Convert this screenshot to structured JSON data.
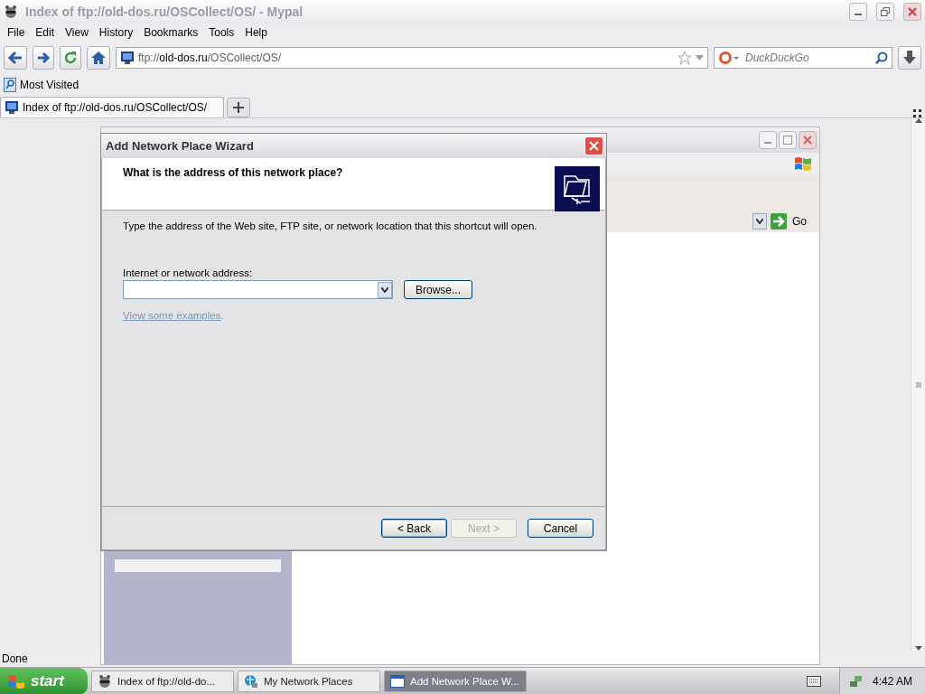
{
  "browser": {
    "title": "Index of ftp://old-dos.ru/OSCollect/OS/ - Mypal",
    "menu": [
      "File",
      "Edit",
      "View",
      "History",
      "Bookmarks",
      "Tools",
      "Help"
    ],
    "url": {
      "scheme": "ftp://",
      "host": "old-dos.ru",
      "path": "/OSCollect/OS/"
    },
    "search": {
      "placeholder": "DuckDuckGo"
    },
    "bookmarks": [
      "Most Visited"
    ],
    "tabs": [
      {
        "label": "Index of ftp://old-dos.ru/OSCollect/OS/",
        "selected": true
      }
    ],
    "status": "Done"
  },
  "background_window": {
    "go_button": "Go"
  },
  "wizard": {
    "title": "Add Network Place Wizard",
    "heading": "What is the address of this network place?",
    "instructions": "Type the address of the Web site, FTP site, or network location that this shortcut will open.",
    "address_label": "Internet or network address:",
    "browse_button": "Browse...",
    "examples_link": "View some examples",
    "examples_end": ".",
    "buttons": [
      {
        "label": "< Back",
        "disabled": false,
        "default": true
      },
      {
        "label": "Next >",
        "disabled": true,
        "default": false
      },
      {
        "label": "Cancel",
        "disabled": false,
        "default": false
      }
    ]
  },
  "taskbar": {
    "start": "start",
    "items": [
      {
        "label": "Index of ftp://old-do...",
        "kind": "browser",
        "selected": false
      },
      {
        "label": "My Network Places",
        "kind": "network",
        "selected": false
      },
      {
        "label": "Add Network Place W...",
        "kind": "window",
        "selected": true
      }
    ],
    "clock": "4:42 AM"
  }
}
